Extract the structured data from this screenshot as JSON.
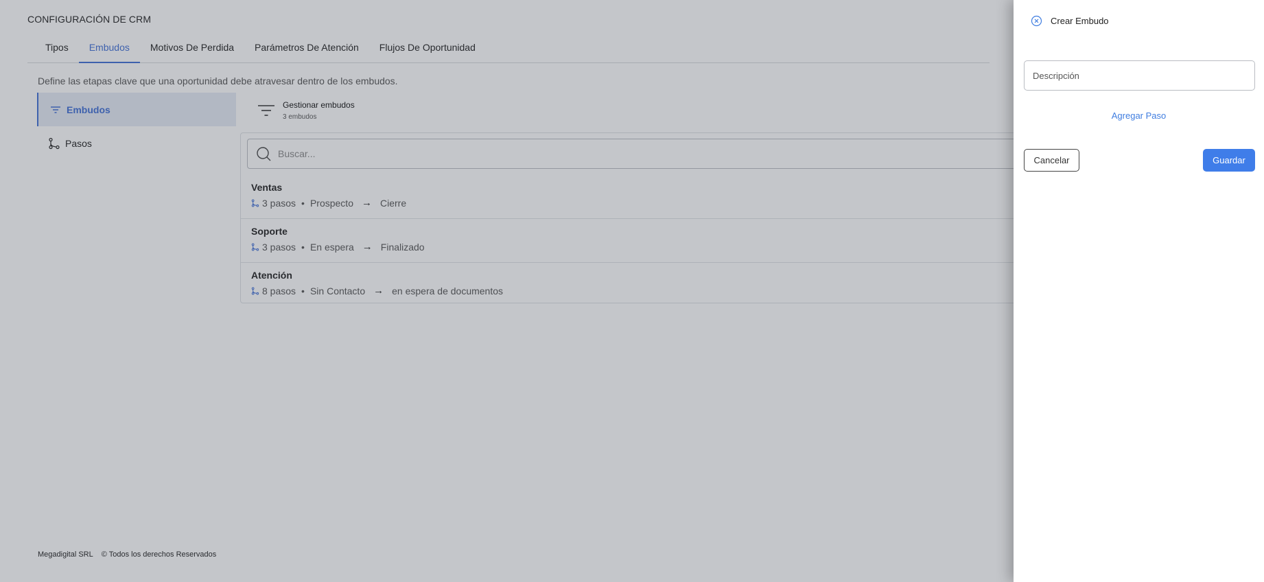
{
  "page": {
    "title": "CONFIGURACIÓN DE CRM",
    "description": "Define las etapas clave que una oportunidad debe atravesar dentro de los embudos."
  },
  "tabs": [
    {
      "label": "Tipos"
    },
    {
      "label": "Embudos"
    },
    {
      "label": "Motivos De Perdida"
    },
    {
      "label": "Parámetros De Atención"
    },
    {
      "label": "Flujos De Oportunidad"
    }
  ],
  "nav": [
    {
      "label": "Embudos",
      "icon": "filter-lines-icon"
    },
    {
      "label": "Pasos",
      "icon": "steps-flow-icon"
    }
  ],
  "manage": {
    "title": "Gestionar embudos",
    "count": "3 embudos",
    "icon": "filter-lines-icon"
  },
  "search": {
    "placeholder": "Buscar...",
    "icon": "search-icon"
  },
  "funnels": [
    {
      "name": "Ventas",
      "steps": "3 pasos",
      "separator": "•",
      "from": "Prospecto",
      "arrow": "→",
      "to": "Cierre"
    },
    {
      "name": "Soporte",
      "steps": "3 pasos",
      "separator": "•",
      "from": "En espera",
      "arrow": "→",
      "to": "Finalizado"
    },
    {
      "name": "Atención",
      "steps": "8 pasos",
      "separator": "•",
      "from": "Sin Contacto",
      "arrow": "→",
      "to": "en espera de documentos"
    }
  ],
  "footer": {
    "company": "Megadigital SRL",
    "rights": "© Todos los derechos Reservados"
  },
  "drawer": {
    "title": "Crear Embudo",
    "close_icon": "close-circle-icon",
    "description_placeholder": "Descripción",
    "add_step_label": "Agregar Paso",
    "cancel_label": "Cancelar",
    "save_label": "Guardar"
  },
  "colors": {
    "accent": "#3f6fd6",
    "primary_button": "#3f7de9",
    "overlay": "rgba(60,66,80,0.30)"
  }
}
